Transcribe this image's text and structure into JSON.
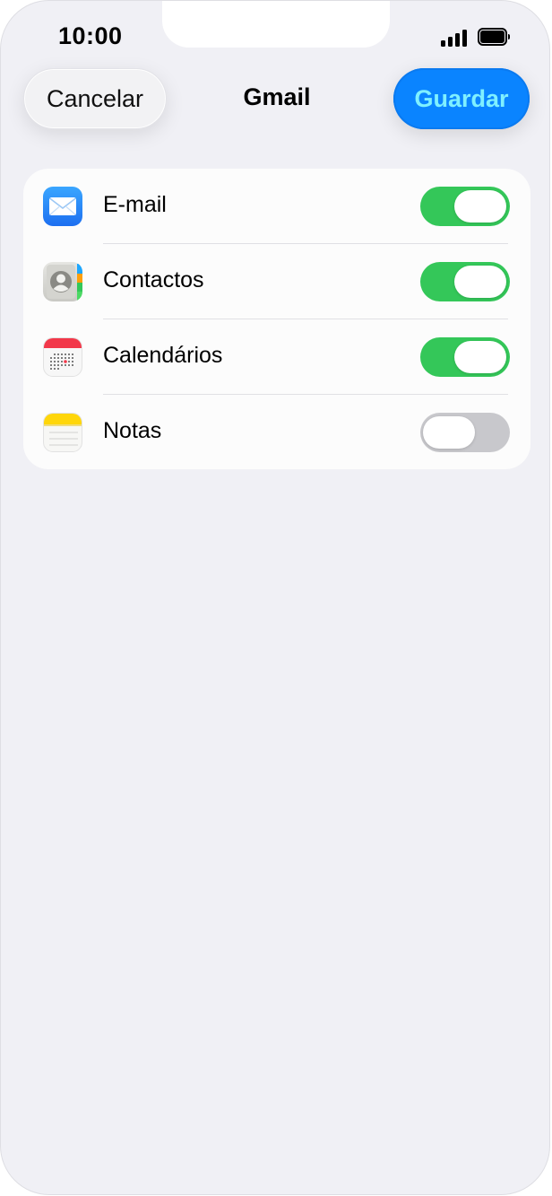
{
  "status_bar": {
    "time": "10:00"
  },
  "nav": {
    "cancel_label": "Cancelar",
    "title": "Gmail",
    "save_label": "Guardar"
  },
  "settings": {
    "items": [
      {
        "label": "E-mail",
        "icon": "mail-icon",
        "enabled": true
      },
      {
        "label": "Contactos",
        "icon": "contacts-icon",
        "enabled": true
      },
      {
        "label": "Calendários",
        "icon": "calendar-icon",
        "enabled": true
      },
      {
        "label": "Notas",
        "icon": "notes-icon",
        "enabled": false
      }
    ]
  },
  "colors": {
    "accent": "#0a84ff",
    "toggle_on": "#34c759",
    "toggle_off": "#c8c8cc",
    "background": "#f0f0f5"
  }
}
